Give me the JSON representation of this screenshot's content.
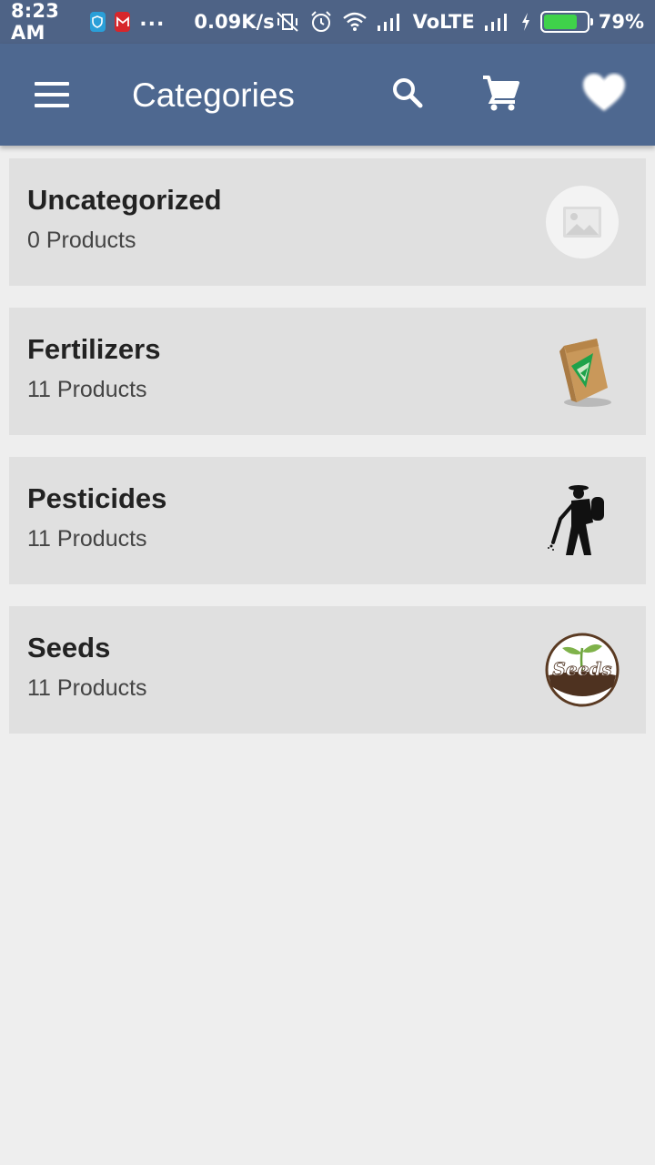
{
  "status_bar": {
    "time": "8:23 AM",
    "notifications": [
      "shield-app-icon",
      "gmail-icon"
    ],
    "more": "...",
    "speed": "0.09K/s",
    "network": "VoLTE",
    "battery": "79%",
    "battery_level": 0.79,
    "icons": [
      "vibrate-off-icon",
      "alarm-icon",
      "wifi-icon",
      "signal-icon",
      "signal-icon",
      "charging-icon"
    ]
  },
  "app_bar": {
    "title": "Categories",
    "menu_icon": "hamburger-menu-icon",
    "actions": [
      "search-icon",
      "cart-icon",
      "heart-icon"
    ],
    "color": "#4e6890"
  },
  "categories": [
    {
      "name": "Uncategorized",
      "count": "0 Products",
      "thumbnail": "placeholder-image-icon"
    },
    {
      "name": "Fertilizers",
      "count": "11 Products",
      "thumbnail": "fertilizer-bag-image"
    },
    {
      "name": "Pesticides",
      "count": "11 Products",
      "thumbnail": "pesticide-sprayer-image"
    },
    {
      "name": "Seeds",
      "count": "11 Products",
      "thumbnail": "seeds-logo-image"
    }
  ],
  "seeds_logo_text": "Seeds"
}
